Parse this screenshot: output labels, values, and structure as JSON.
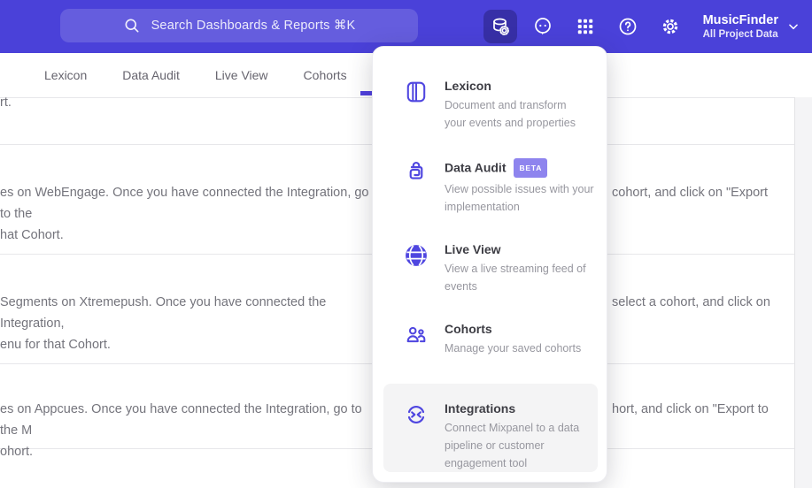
{
  "header": {
    "search_placeholder": "Search Dashboards & Reports ⌘K",
    "project_name": "MusicFinder",
    "project_subtitle": "All Project Data",
    "colors": {
      "bar": "#4a41d9",
      "active_icon_bg": "#372fa7",
      "accent": "#4f3fde"
    }
  },
  "tabs": {
    "items": [
      {
        "label": "Lexicon"
      },
      {
        "label": "Data Audit"
      },
      {
        "label": "Live View"
      },
      {
        "label": "Cohorts"
      }
    ]
  },
  "background_rows": [
    {
      "left": "rt.",
      "right": ""
    },
    {
      "left": "es on WebEngage. Once you have connected the Integration, go to the\nhat Cohort.",
      "right": "cohort, and click on \"Export"
    },
    {
      "left": "Segments on Xtremepush. Once you have connected the Integration,\nenu for that Cohort.",
      "right": "select a cohort, and click on"
    },
    {
      "left": "es on Appcues. Once you have connected the Integration, go to the M\nohort.",
      "right": "hort, and click on \"Export to"
    }
  ],
  "menu": {
    "items": [
      {
        "title": "Lexicon",
        "icon": "book-icon",
        "description": "Document and transform\nyour events and properties"
      },
      {
        "title": "Data Audit",
        "icon": "audit-icon",
        "badge": "BETA",
        "description": "View possible issues with your\nimplementation"
      },
      {
        "title": "Live View",
        "icon": "globe-icon",
        "description": "View a live streaming feed of\nevents"
      },
      {
        "title": "Cohorts",
        "icon": "users-icon",
        "description": "Manage your saved cohorts"
      },
      {
        "title": "Integrations",
        "icon": "sync-icon",
        "highlighted": true,
        "description": "Connect Mixpanel to a data\npipeline or customer\nengagement tool"
      }
    ],
    "icon_color": "#4f46e0"
  }
}
